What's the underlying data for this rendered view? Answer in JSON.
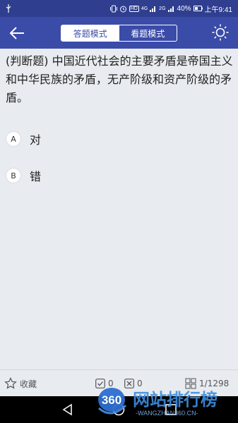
{
  "status_bar": {
    "usb_icon": "usb-icon",
    "hd_label": "HD",
    "network_4g": "4G",
    "network_2g": "2G",
    "battery": "40%",
    "time": "上午9:41"
  },
  "app_bar": {
    "back_icon": "arrow-left-icon",
    "tabs": [
      {
        "label": "答题模式",
        "active": true
      },
      {
        "label": "看题模式",
        "active": false
      }
    ],
    "brightness_icon": "sun-icon"
  },
  "question": {
    "text": "(判断题) 中国近代社会的主要矛盾是帝国主义和中华民族的矛盾，无产阶级和资产阶级的矛盾。"
  },
  "options": [
    {
      "letter": "A",
      "text": "对"
    },
    {
      "letter": "B",
      "text": "错"
    }
  ],
  "bottom_bar": {
    "favorite_label": "收藏",
    "correct_count": "0",
    "wrong_count": "0",
    "progress": "1/1298"
  },
  "watermark": {
    "logo_text": "360",
    "title": "网站排行榜",
    "subtitle": "-WANGZHAN360.CN-"
  },
  "colors": {
    "status_bar": "#2f3e8f",
    "app_bar": "#3a4ba8",
    "background": "#e8ebef"
  }
}
